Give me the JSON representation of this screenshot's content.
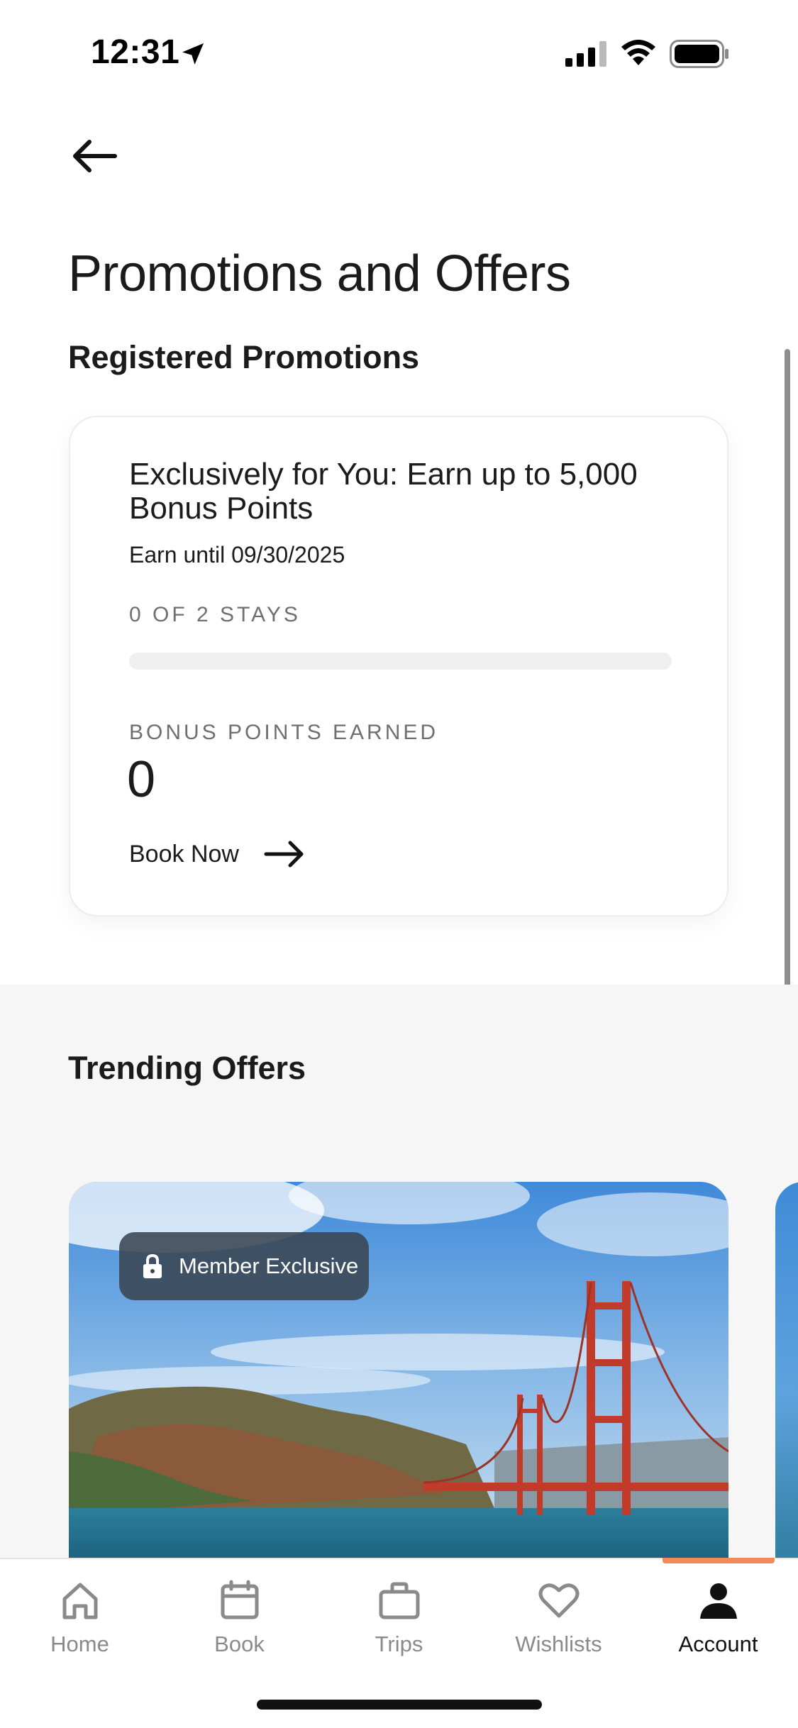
{
  "status_bar": {
    "time": "12:31"
  },
  "page": {
    "title": "Promotions and Offers"
  },
  "registered": {
    "heading": "Registered Promotions",
    "promo": {
      "title": "Exclusively for You: Earn up to 5,000 Bonus Points",
      "date": "Earn until 09/30/2025",
      "stays_label": "0 OF 2 STAYS",
      "progress": 0,
      "bonus_label": "BONUS POINTS EARNED",
      "bonus_value": "0",
      "cta": "Book Now"
    }
  },
  "trending": {
    "heading": "Trending Offers",
    "offers": [
      {
        "badge": "Member Exclusive"
      }
    ]
  },
  "tabs": [
    {
      "label": "Home",
      "icon": "home-icon"
    },
    {
      "label": "Book",
      "icon": "calendar-icon"
    },
    {
      "label": "Trips",
      "icon": "suitcase-icon"
    },
    {
      "label": "Wishlists",
      "icon": "heart-icon"
    },
    {
      "label": "Account",
      "icon": "person-icon",
      "active": true
    }
  ],
  "colors": {
    "accent": "#f28a5c",
    "badge_bg": "#3a4652"
  }
}
